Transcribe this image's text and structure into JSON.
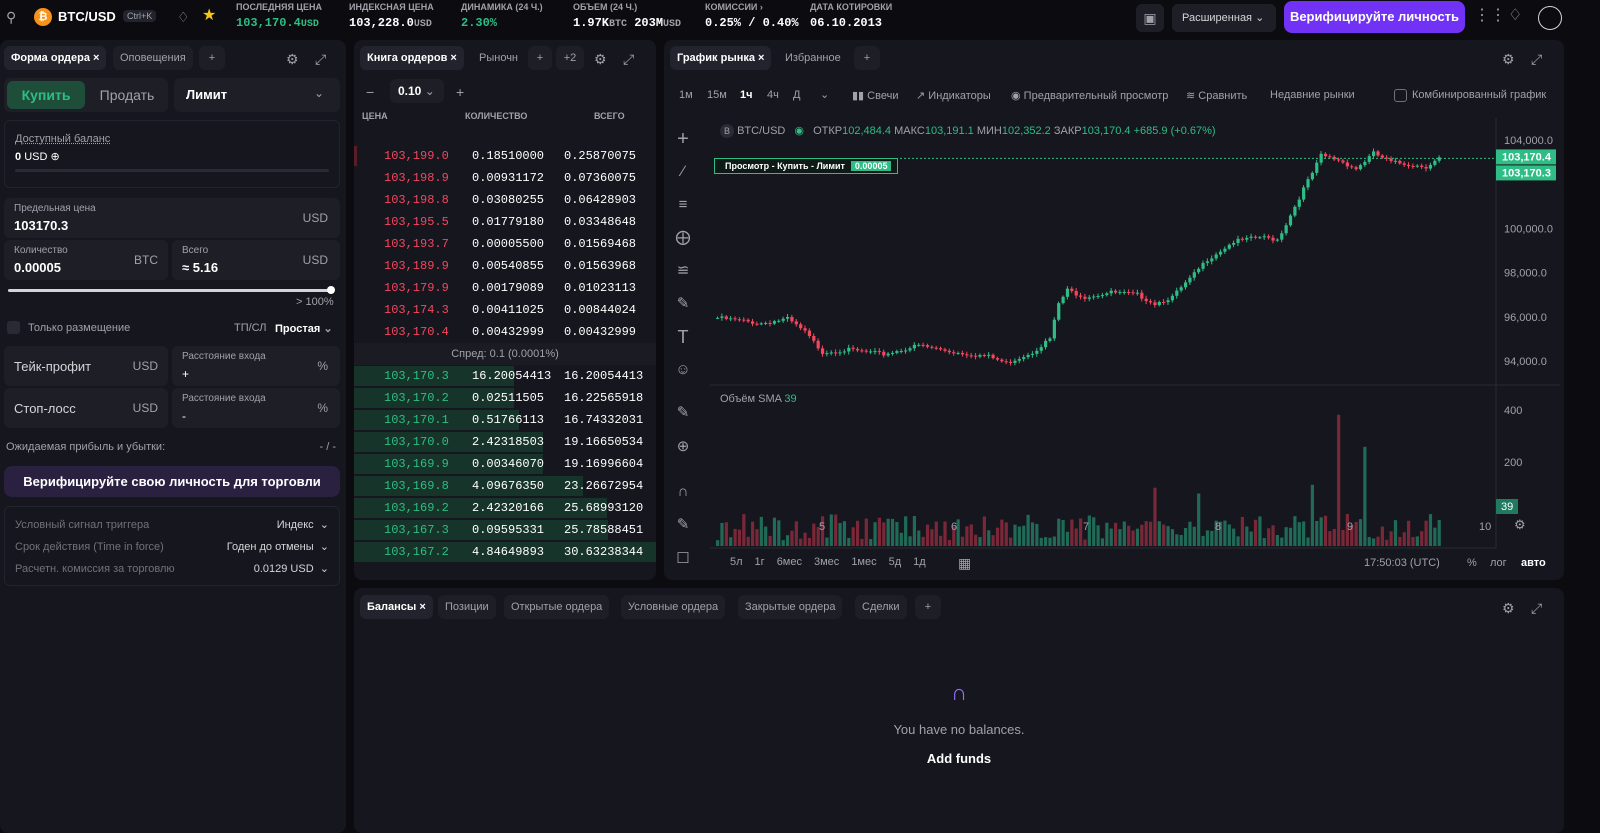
{
  "header": {
    "pair": "BTC/USD",
    "shortcut": "Ctrl+K",
    "stats": [
      {
        "label": "ПОСЛЕДНЯЯ ЦЕНА",
        "value": "103,170.4",
        "unit": "USD"
      },
      {
        "label": "ИНДЕКСНАЯ ЦЕНА",
        "value": "103,228.0",
        "unit": "USD"
      },
      {
        "label": "ДИНАМИКА (24 Ч.)",
        "value": "2.30%"
      },
      {
        "label": "ОБЪЕМ (24 Ч.)",
        "value": "1.97K",
        "unit": "BTC",
        "value2": "203M",
        "unit2": "USD"
      },
      {
        "label": "КОМИССИИ",
        "value": "0.25% / 0.40%"
      },
      {
        "label": "ДАТА КОТИРОВКИ",
        "value": "06.10.2013"
      }
    ],
    "mode": "Расширенная",
    "verify": "Верифицируйте личность"
  },
  "order_form": {
    "tabs": [
      "Форма ордера",
      "Оповещения"
    ],
    "buy": "Купить",
    "sell": "Продать",
    "order_type": "Лимит",
    "balance_label": "Доступный баланс",
    "balance_value": "0",
    "balance_unit": "USD",
    "limit_label": "Предельная цена",
    "limit_value": "103170.3",
    "limit_unit": "USD",
    "qty_label": "Количество",
    "qty_value": "0.00005",
    "qty_unit": "BTC",
    "total_label": "Всего",
    "total_value": "≈ 5.16",
    "total_unit": "USD",
    "slider_pct": "> 100%",
    "slider_fraction": 1.0,
    "post_only": "Только размещение",
    "tpsl_label": "ТП/СЛ",
    "tpsl_value": "Простая",
    "tp_label": "Тейк-профит",
    "tp_unit": "USD",
    "entry1_label": "Расстояние входа",
    "entry1_sign": "+",
    "pct": "%",
    "sl_label": "Стоп-лосс",
    "sl_unit": "USD",
    "entry2_label": "Расстояние входа",
    "entry2_sign": "-",
    "pnl_label": "Ожидаемая прибыль и убытки:",
    "pnl_value": "- / -",
    "verify_btn": "Верифицируйте свою личность для торговли",
    "trigger_label": "Условный сигнал триггера",
    "trigger_value": "Индекс",
    "tif_label": "Срок действия (Time in force)",
    "tif_value": "Годен до отмены",
    "fee_label": "Расчетн. комиссия за торговлю",
    "fee_value": "0.0129 USD"
  },
  "orderbook": {
    "tabs": [
      "Книга ордеров",
      "Рыночн"
    ],
    "plus_more": "+2",
    "step": "0.10",
    "headers": [
      "ЦЕНА",
      "КОЛИЧЕСТВО",
      "ВСЕГО"
    ],
    "asks": [
      [
        "103,199.0",
        "0.18510000",
        "0.25870075"
      ],
      [
        "103,198.9",
        "0.00931172",
        "0.07360075"
      ],
      [
        "103,198.8",
        "0.03080255",
        "0.06428903"
      ],
      [
        "103,195.5",
        "0.01779180",
        "0.03348648"
      ],
      [
        "103,193.7",
        "0.00005500",
        "0.01569468"
      ],
      [
        "103,189.9",
        "0.00540855",
        "0.01563968"
      ],
      [
        "103,179.9",
        "0.00179089",
        "0.01023113"
      ],
      [
        "103,174.3",
        "0.00411025",
        "0.00844024"
      ],
      [
        "103,170.4",
        "0.00432999",
        "0.00432999"
      ]
    ],
    "spread": "Спред: 0.1 (0.0001%)",
    "bids": [
      [
        "103,170.3",
        "16.20054413",
        "16.20054413"
      ],
      [
        "103,170.2",
        "0.02511505",
        "16.22565918"
      ],
      [
        "103,170.1",
        "0.51766113",
        "16.74332031"
      ],
      [
        "103,170.0",
        "2.42318503",
        "19.16650534"
      ],
      [
        "103,169.9",
        "0.00346070",
        "19.16996604"
      ],
      [
        "103,169.8",
        "4.09676350",
        "23.26672954"
      ],
      [
        "103,169.2",
        "2.42320166",
        "25.68993120"
      ],
      [
        "103,167.3",
        "0.09595331",
        "25.78588451"
      ],
      [
        "103,167.2",
        "4.84649893",
        "30.63238344"
      ]
    ]
  },
  "chart": {
    "tabs": [
      "График рынка",
      "Избранное"
    ],
    "timeframes": [
      "1м",
      "15м",
      "1ч",
      "4ч",
      "Д"
    ],
    "active_tf": "1ч",
    "tools": [
      "Свечи",
      "Индикаторы",
      "Предварительный просмотр",
      "Сравнить",
      "Недавние рынки",
      "Комбинированный график"
    ],
    "legend": {
      "pair": "BTC/USD",
      "o_label": "ОТКР",
      "o": "102,484.4",
      "h_label": "МАКС",
      "h": "103,191.1",
      "l_label": "МИН",
      "l": "102,352.2",
      "c_label": "ЗАКР",
      "c": "103,170.4",
      "chg": "+685.9 (+0.67%)"
    },
    "preview_label": "Просмотр - Купить - Лимит",
    "preview_value": "0.00005",
    "price_ticks": [
      "104,000.0",
      "100,000.0",
      "98,000.0",
      "96,000.0",
      "94,000.0"
    ],
    "price_tags": [
      "103,170.4",
      "103,170.3"
    ],
    "volume_label": "Объём SMA",
    "volume_value": "39",
    "vol_ticks": [
      "400",
      "200"
    ],
    "vol_tag": "39",
    "x_ticks": [
      "5",
      "6",
      "7",
      "8",
      "9",
      "10"
    ],
    "ranges": [
      "5л",
      "1г",
      "6мес",
      "3мес",
      "1мес",
      "5д",
      "1д"
    ],
    "time": "17:50:03 (UTC)",
    "scale": [
      "%",
      "лог",
      "авто"
    ],
    "chart_data": {
      "type": "candlestick",
      "ylim": [
        93000,
        105000
      ],
      "x_ticks": [
        "5",
        "6",
        "7",
        "8",
        "9",
        "10"
      ]
    }
  },
  "bottom": {
    "tabs": [
      "Балансы",
      "Позиции",
      "Открытые ордера",
      "Условные ордера",
      "Закрытые ордера",
      "Сделки"
    ],
    "empty": "You have no balances.",
    "add_funds": "Add funds"
  },
  "colors": {
    "green": "#2ebd85",
    "red": "#f6465d",
    "accent": "#7132f5"
  }
}
